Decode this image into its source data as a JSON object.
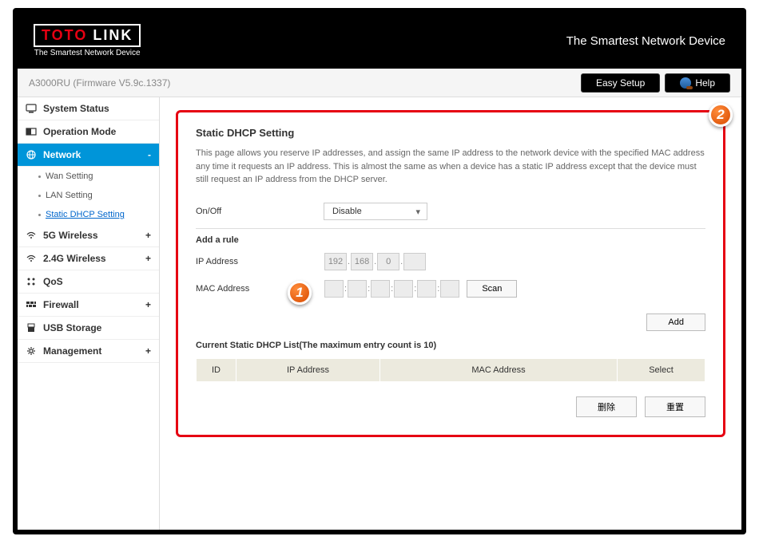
{
  "header": {
    "logo_main_1": "TOTO",
    "logo_main_2": "LINK",
    "logo_sub": "The Smartest Network Device",
    "tagline": "The Smartest Network Device"
  },
  "topbar": {
    "model": "A3000RU (Firmware V5.9c.1337)",
    "easy_setup": "Easy Setup",
    "help": "Help"
  },
  "sidebar": {
    "items": [
      {
        "label": "System Status",
        "exp": ""
      },
      {
        "label": "Operation Mode",
        "exp": ""
      },
      {
        "label": "Network",
        "exp": "-"
      },
      {
        "label": "5G Wireless",
        "exp": "+"
      },
      {
        "label": "2.4G Wireless",
        "exp": "+"
      },
      {
        "label": "QoS",
        "exp": ""
      },
      {
        "label": "Firewall",
        "exp": "+"
      },
      {
        "label": "USB Storage",
        "exp": ""
      },
      {
        "label": "Management",
        "exp": "+"
      }
    ],
    "network_subs": [
      {
        "label": "Wan Setting"
      },
      {
        "label": "LAN Setting"
      },
      {
        "label": "Static DHCP Setting"
      }
    ]
  },
  "main": {
    "title": "Static DHCP Setting",
    "desc": "This page allows you reserve IP addresses, and assign the same IP address to the network device with the specified MAC address any time it requests an IP address. This is almost the same as when a device has a static IP address except that the device must still request an IP address from the DHCP server.",
    "onoff_label": "On/Off",
    "onoff_value": "Disable",
    "add_rule_h": "Add a rule",
    "ip_label": "IP Address",
    "ip": {
      "o1": "192",
      "o2": "168",
      "o3": "0",
      "o4": ""
    },
    "mac_label": "MAC Address",
    "scan": "Scan",
    "add": "Add",
    "list_h": "Current Static DHCP List(The maximum entry count is 10)",
    "th": {
      "id": "ID",
      "ip": "IP Address",
      "mac": "MAC Address",
      "sel": "Select"
    },
    "delete": "删除",
    "reset": "重置"
  },
  "badges": {
    "b1": "1",
    "b2": "2"
  }
}
